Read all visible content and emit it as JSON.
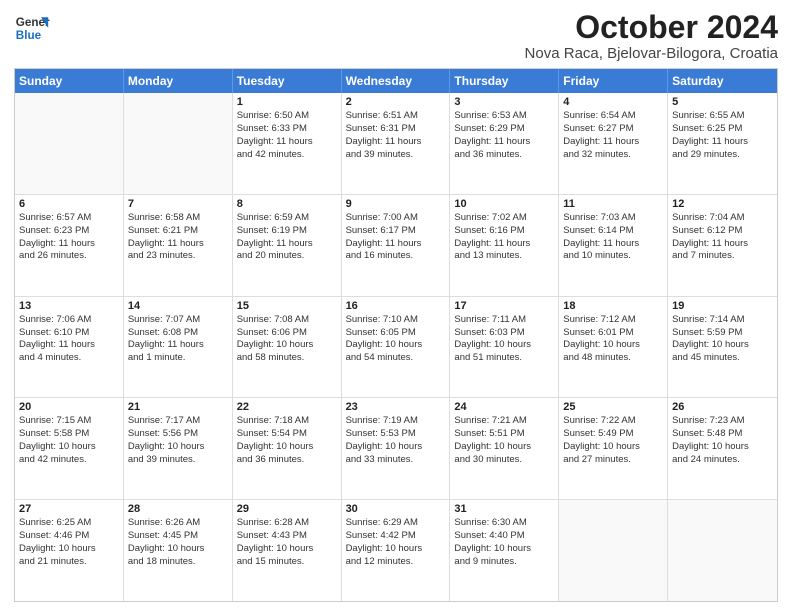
{
  "header": {
    "logo_line1": "General",
    "logo_line2": "Blue",
    "month": "October 2024",
    "location": "Nova Raca, Bjelovar-Bilogora, Croatia"
  },
  "days_of_week": [
    "Sunday",
    "Monday",
    "Tuesday",
    "Wednesday",
    "Thursday",
    "Friday",
    "Saturday"
  ],
  "weeks": [
    [
      {
        "day": "",
        "lines": [],
        "empty": true
      },
      {
        "day": "",
        "lines": [],
        "empty": true
      },
      {
        "day": "1",
        "lines": [
          "Sunrise: 6:50 AM",
          "Sunset: 6:33 PM",
          "Daylight: 11 hours",
          "and 42 minutes."
        ]
      },
      {
        "day": "2",
        "lines": [
          "Sunrise: 6:51 AM",
          "Sunset: 6:31 PM",
          "Daylight: 11 hours",
          "and 39 minutes."
        ]
      },
      {
        "day": "3",
        "lines": [
          "Sunrise: 6:53 AM",
          "Sunset: 6:29 PM",
          "Daylight: 11 hours",
          "and 36 minutes."
        ]
      },
      {
        "day": "4",
        "lines": [
          "Sunrise: 6:54 AM",
          "Sunset: 6:27 PM",
          "Daylight: 11 hours",
          "and 32 minutes."
        ]
      },
      {
        "day": "5",
        "lines": [
          "Sunrise: 6:55 AM",
          "Sunset: 6:25 PM",
          "Daylight: 11 hours",
          "and 29 minutes."
        ]
      }
    ],
    [
      {
        "day": "6",
        "lines": [
          "Sunrise: 6:57 AM",
          "Sunset: 6:23 PM",
          "Daylight: 11 hours",
          "and 26 minutes."
        ]
      },
      {
        "day": "7",
        "lines": [
          "Sunrise: 6:58 AM",
          "Sunset: 6:21 PM",
          "Daylight: 11 hours",
          "and 23 minutes."
        ]
      },
      {
        "day": "8",
        "lines": [
          "Sunrise: 6:59 AM",
          "Sunset: 6:19 PM",
          "Daylight: 11 hours",
          "and 20 minutes."
        ]
      },
      {
        "day": "9",
        "lines": [
          "Sunrise: 7:00 AM",
          "Sunset: 6:17 PM",
          "Daylight: 11 hours",
          "and 16 minutes."
        ]
      },
      {
        "day": "10",
        "lines": [
          "Sunrise: 7:02 AM",
          "Sunset: 6:16 PM",
          "Daylight: 11 hours",
          "and 13 minutes."
        ]
      },
      {
        "day": "11",
        "lines": [
          "Sunrise: 7:03 AM",
          "Sunset: 6:14 PM",
          "Daylight: 11 hours",
          "and 10 minutes."
        ]
      },
      {
        "day": "12",
        "lines": [
          "Sunrise: 7:04 AM",
          "Sunset: 6:12 PM",
          "Daylight: 11 hours",
          "and 7 minutes."
        ]
      }
    ],
    [
      {
        "day": "13",
        "lines": [
          "Sunrise: 7:06 AM",
          "Sunset: 6:10 PM",
          "Daylight: 11 hours",
          "and 4 minutes."
        ]
      },
      {
        "day": "14",
        "lines": [
          "Sunrise: 7:07 AM",
          "Sunset: 6:08 PM",
          "Daylight: 11 hours",
          "and 1 minute."
        ]
      },
      {
        "day": "15",
        "lines": [
          "Sunrise: 7:08 AM",
          "Sunset: 6:06 PM",
          "Daylight: 10 hours",
          "and 58 minutes."
        ]
      },
      {
        "day": "16",
        "lines": [
          "Sunrise: 7:10 AM",
          "Sunset: 6:05 PM",
          "Daylight: 10 hours",
          "and 54 minutes."
        ]
      },
      {
        "day": "17",
        "lines": [
          "Sunrise: 7:11 AM",
          "Sunset: 6:03 PM",
          "Daylight: 10 hours",
          "and 51 minutes."
        ]
      },
      {
        "day": "18",
        "lines": [
          "Sunrise: 7:12 AM",
          "Sunset: 6:01 PM",
          "Daylight: 10 hours",
          "and 48 minutes."
        ]
      },
      {
        "day": "19",
        "lines": [
          "Sunrise: 7:14 AM",
          "Sunset: 5:59 PM",
          "Daylight: 10 hours",
          "and 45 minutes."
        ]
      }
    ],
    [
      {
        "day": "20",
        "lines": [
          "Sunrise: 7:15 AM",
          "Sunset: 5:58 PM",
          "Daylight: 10 hours",
          "and 42 minutes."
        ]
      },
      {
        "day": "21",
        "lines": [
          "Sunrise: 7:17 AM",
          "Sunset: 5:56 PM",
          "Daylight: 10 hours",
          "and 39 minutes."
        ]
      },
      {
        "day": "22",
        "lines": [
          "Sunrise: 7:18 AM",
          "Sunset: 5:54 PM",
          "Daylight: 10 hours",
          "and 36 minutes."
        ]
      },
      {
        "day": "23",
        "lines": [
          "Sunrise: 7:19 AM",
          "Sunset: 5:53 PM",
          "Daylight: 10 hours",
          "and 33 minutes."
        ]
      },
      {
        "day": "24",
        "lines": [
          "Sunrise: 7:21 AM",
          "Sunset: 5:51 PM",
          "Daylight: 10 hours",
          "and 30 minutes."
        ]
      },
      {
        "day": "25",
        "lines": [
          "Sunrise: 7:22 AM",
          "Sunset: 5:49 PM",
          "Daylight: 10 hours",
          "and 27 minutes."
        ]
      },
      {
        "day": "26",
        "lines": [
          "Sunrise: 7:23 AM",
          "Sunset: 5:48 PM",
          "Daylight: 10 hours",
          "and 24 minutes."
        ]
      }
    ],
    [
      {
        "day": "27",
        "lines": [
          "Sunrise: 6:25 AM",
          "Sunset: 4:46 PM",
          "Daylight: 10 hours",
          "and 21 minutes."
        ]
      },
      {
        "day": "28",
        "lines": [
          "Sunrise: 6:26 AM",
          "Sunset: 4:45 PM",
          "Daylight: 10 hours",
          "and 18 minutes."
        ]
      },
      {
        "day": "29",
        "lines": [
          "Sunrise: 6:28 AM",
          "Sunset: 4:43 PM",
          "Daylight: 10 hours",
          "and 15 minutes."
        ]
      },
      {
        "day": "30",
        "lines": [
          "Sunrise: 6:29 AM",
          "Sunset: 4:42 PM",
          "Daylight: 10 hours",
          "and 12 minutes."
        ]
      },
      {
        "day": "31",
        "lines": [
          "Sunrise: 6:30 AM",
          "Sunset: 4:40 PM",
          "Daylight: 10 hours",
          "and 9 minutes."
        ]
      },
      {
        "day": "",
        "lines": [],
        "empty": true
      },
      {
        "day": "",
        "lines": [],
        "empty": true
      }
    ]
  ]
}
